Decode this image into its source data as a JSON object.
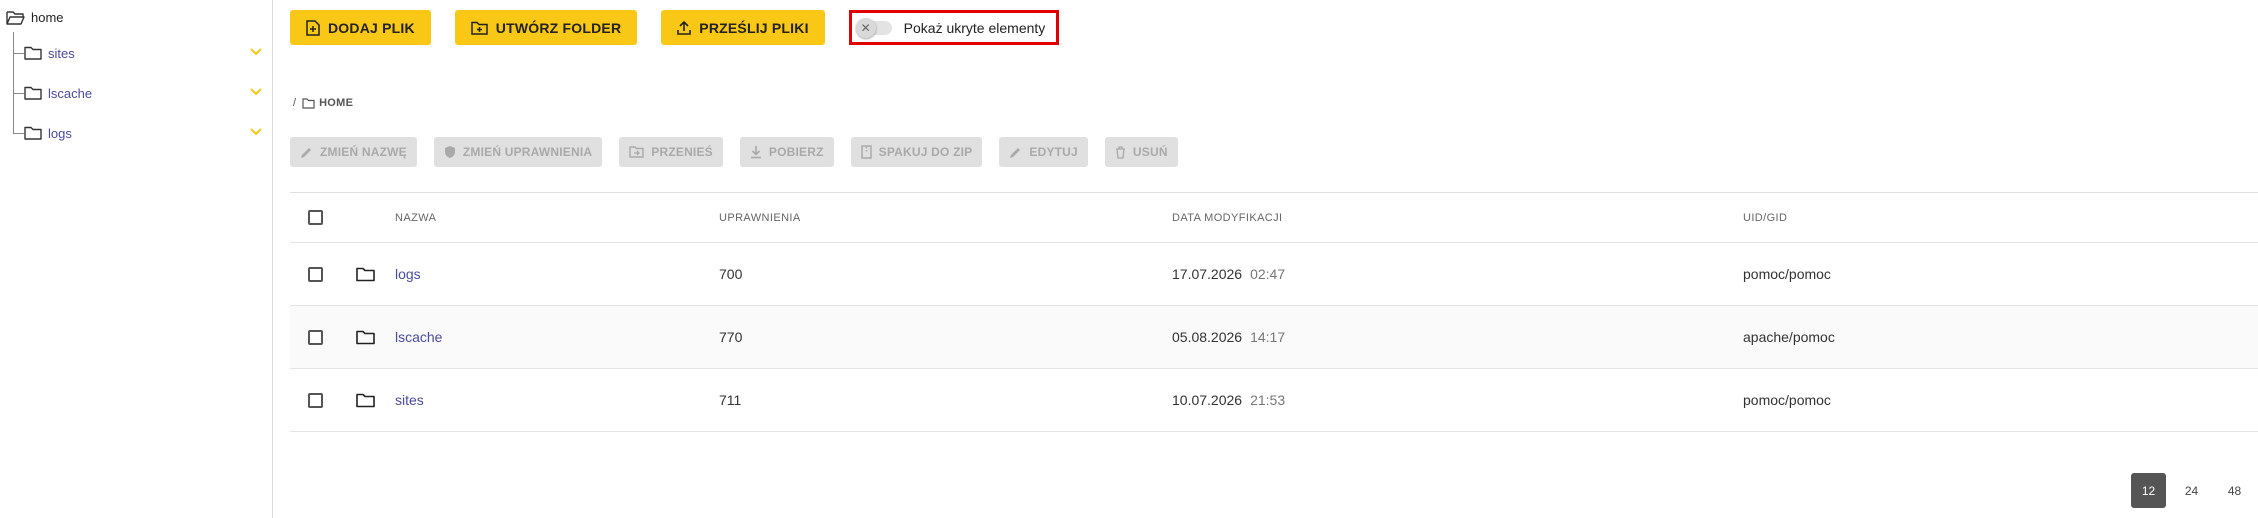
{
  "sidebar": {
    "root": {
      "label": "home",
      "icon": "folder-open-icon"
    },
    "items": [
      {
        "label": "sites",
        "icon": "folder-icon"
      },
      {
        "label": "lscache",
        "icon": "folder-icon"
      },
      {
        "label": "logs",
        "icon": "folder-icon"
      }
    ],
    "chevron_color": "#f9c716"
  },
  "toolbar": {
    "add_file": "DODAJ PLIK",
    "create_folder": "UTWÓRZ FOLDER",
    "upload_files": "PRZEŚLIJ PLIKI",
    "show_hidden_label": "Pokaż ukryte elementy",
    "show_hidden_enabled": false,
    "accent": "#f9c716",
    "highlight": "#e10000"
  },
  "breadcrumb": {
    "separator": "/",
    "current": "HOME"
  },
  "actions": {
    "rename": "ZMIEŃ NAZWĘ",
    "permissions": "ZMIEŃ UPRAWNIENIA",
    "move": "PRZENIEŚ",
    "download": "POBIERZ",
    "zip": "SPAKUJ DO ZIP",
    "edit": "EDYTUJ",
    "delete": "USUŃ"
  },
  "table": {
    "columns": [
      "NAZWA",
      "UPRAWNIENIA",
      "DATA MODYFIKACJI",
      "UID/GID"
    ],
    "rows": [
      {
        "name": "logs",
        "permissions": "700",
        "date": "17.07.2026",
        "time": "02:47",
        "uid_gid": "pomoc/pomoc"
      },
      {
        "name": "lscache",
        "permissions": "770",
        "date": "05.08.2026",
        "time": "14:17",
        "uid_gid": "apache/pomoc"
      },
      {
        "name": "sites",
        "permissions": "711",
        "date": "10.07.2026",
        "time": "21:53",
        "uid_gid": "pomoc/pomoc"
      }
    ]
  },
  "pagination": {
    "sizes": [
      "12",
      "24",
      "48"
    ],
    "selected": "12"
  }
}
